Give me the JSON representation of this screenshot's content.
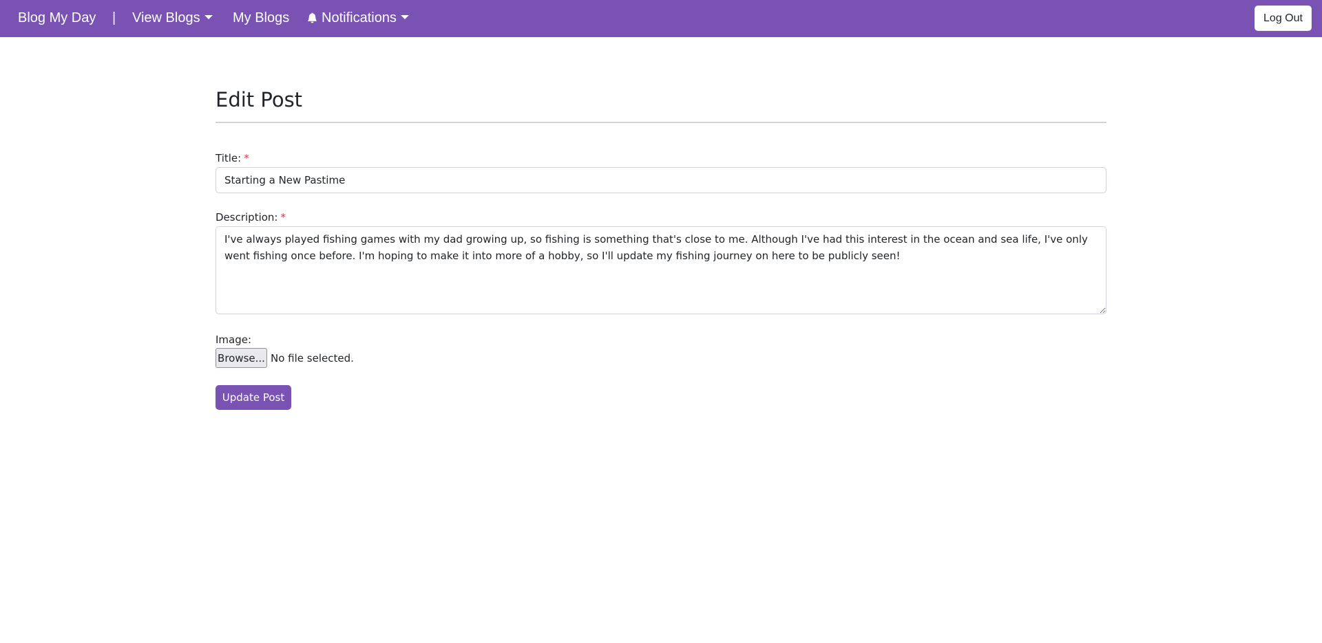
{
  "navbar": {
    "brand": "Blog My Day",
    "separator": "|",
    "view_blogs": "View Blogs",
    "my_blogs": "My Blogs",
    "notifications": "Notifications",
    "logout": "Log Out",
    "background_color": "#7952b3"
  },
  "form": {
    "heading": "Edit Post",
    "title_label": "Title:",
    "title_required": "*",
    "title_value": "Starting a New Pastime",
    "description_label": "Description:",
    "description_required": "*",
    "description_value": "I've always played fishing games with my dad growing up, so fishing is something that's close to me. Although I've had this interest in the ocean and sea life, I've only went fishing once before. I'm hoping to make it into more of a hobby, so I'll update my fishing journey on here to be publicly seen!",
    "image_label": "Image:",
    "browse_label": "Browse...",
    "file_status": "No file selected.",
    "submit_label": "Update Post",
    "accent_color": "#7952b3",
    "required_color": "#dc3545"
  }
}
